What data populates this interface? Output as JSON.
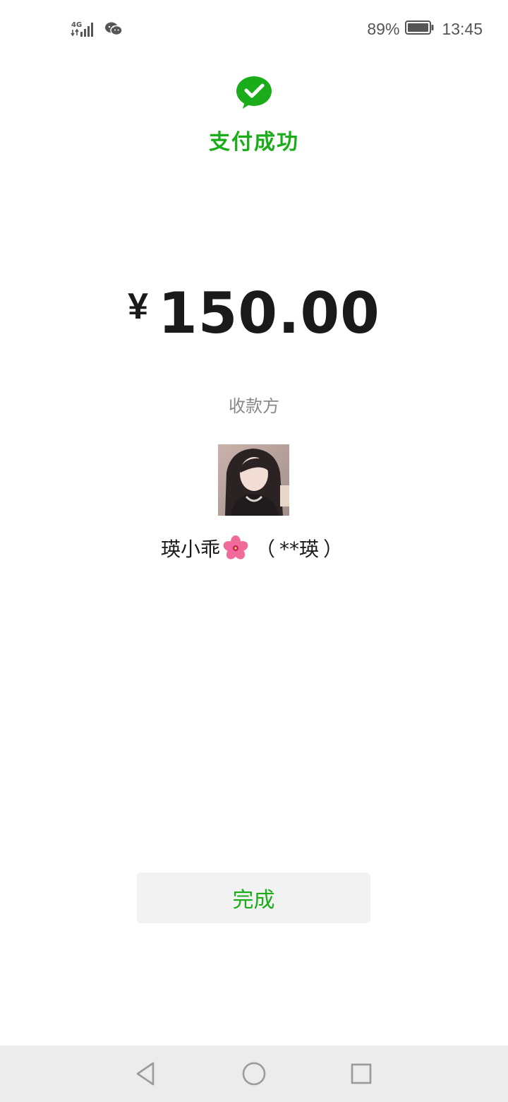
{
  "status_bar": {
    "network": "4G",
    "battery_percent": "89%",
    "time": "13:45",
    "icons": [
      "signal-icon",
      "wechat-notification-icon",
      "battery-icon"
    ]
  },
  "header": {
    "icon": "check-bubble-icon",
    "title": "支付成功",
    "accent_color": "#1aad19"
  },
  "payment": {
    "currency_symbol": "¥",
    "amount": "150.00"
  },
  "payee": {
    "label": "收款方",
    "nickname": "瑛小乖",
    "nickname_emoji": "hibiscus-icon",
    "real_name_open": "（",
    "real_name": "**瑛",
    "real_name_close": "）"
  },
  "actions": {
    "done_label": "完成"
  },
  "nav_bar": {
    "buttons": [
      "back-icon",
      "home-icon",
      "recents-icon"
    ]
  }
}
